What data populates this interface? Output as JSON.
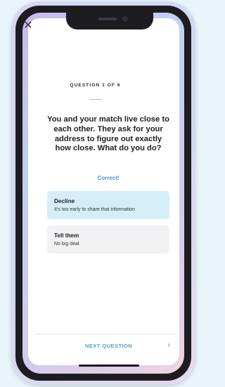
{
  "header": {
    "close_icon": "close-icon",
    "close_glyph": "✕"
  },
  "quiz": {
    "question_counter": "QUESTION 1 OF 6",
    "question_text": "You and your match live close to each other. They ask for your address to figure out exactly how close. What do you do?",
    "feedback": "Correct!",
    "feedback_color": "#3a9ad3",
    "options": [
      {
        "title": "Decline",
        "subtitle": "It's too early to share that information",
        "selected": true
      },
      {
        "title": "Tell them",
        "subtitle": "No big deal",
        "selected": false
      }
    ]
  },
  "footer": {
    "next_label": "NEXT QUESTION",
    "next_arrow_icon": "chevron-right-icon",
    "next_arrow_glyph": "›",
    "accent_color": "#4aa3da"
  }
}
